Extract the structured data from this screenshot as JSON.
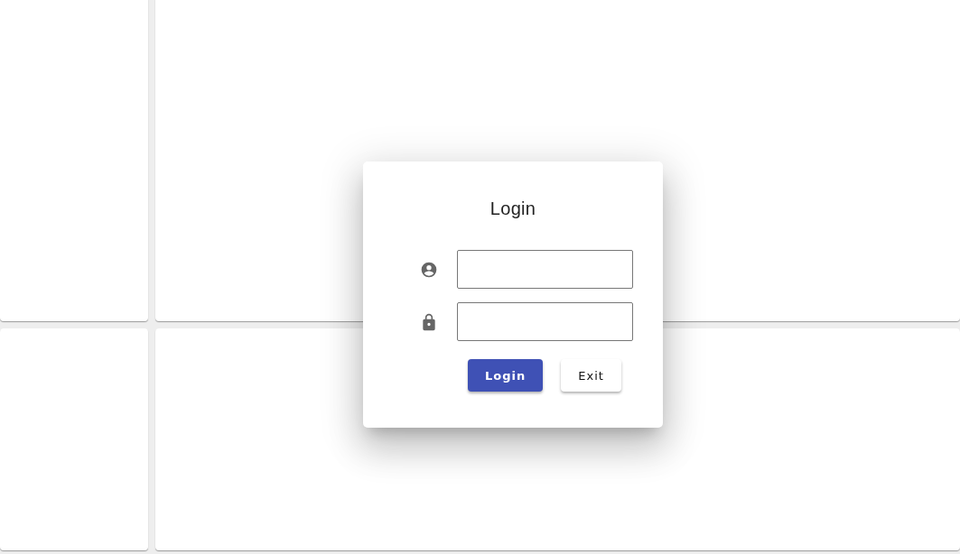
{
  "background": {
    "panels": [
      {
        "kind": "panel"
      },
      {
        "kind": "panel"
      },
      {
        "kind": "panel"
      },
      {
        "kind": "panel"
      }
    ]
  },
  "dialog": {
    "title": "Login",
    "fields": [
      {
        "kind": "user"
      },
      {
        "kind": "password"
      }
    ],
    "buttons": [
      {
        "label": "Login",
        "kind": "primary"
      },
      {
        "label": "Exit",
        "kind": "secondary"
      }
    ]
  }
}
